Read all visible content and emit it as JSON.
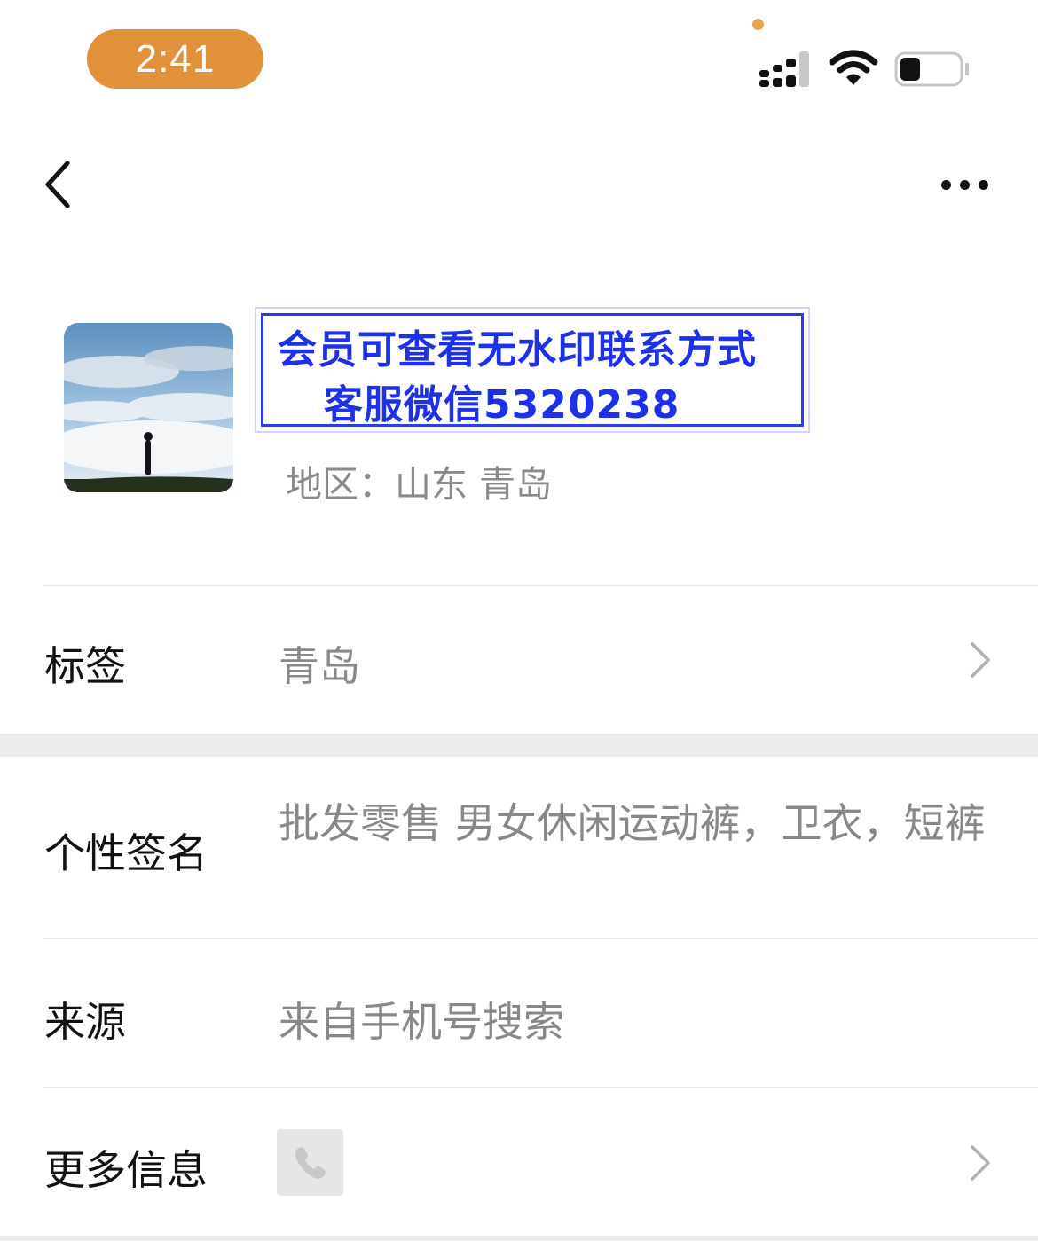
{
  "status_bar": {
    "time": "2:41",
    "accent_color": "#e0913a",
    "icons": [
      "cellular-signal-icon",
      "wifi-icon",
      "battery-icon"
    ]
  },
  "nav": {
    "back_icon": "chevron-left-icon",
    "more_icon": "ellipsis-icon"
  },
  "profile": {
    "watermark_line1": "会员可查看无水印联系方式",
    "watermark_line2": "客服微信5320238",
    "region": "地区：山东 青岛"
  },
  "rows": {
    "tags": {
      "label": "标签",
      "value": "青岛"
    },
    "signature": {
      "label": "个性签名",
      "value": "批发零售 男女休闲运动裤，卫衣，短裤"
    },
    "source": {
      "label": "来源",
      "value": "来自手机号搜索"
    },
    "more_info": {
      "label": "更多信息",
      "icon": "phone-icon"
    }
  }
}
